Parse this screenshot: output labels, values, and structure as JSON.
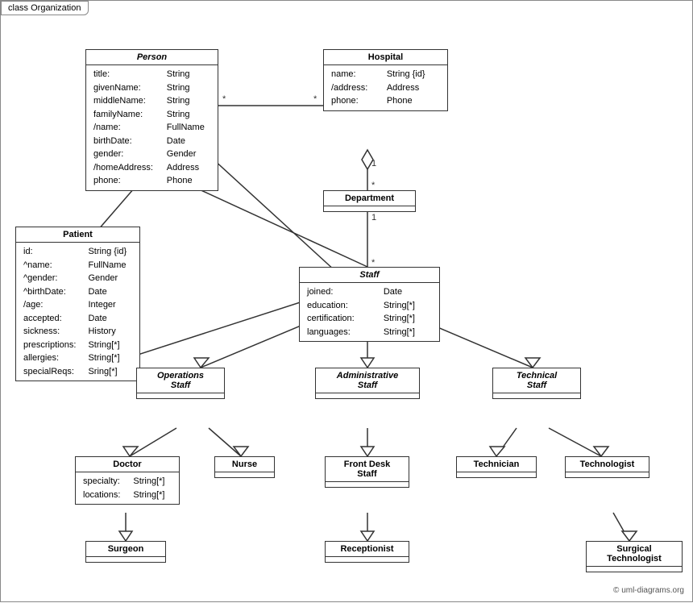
{
  "diagram": {
    "title": "class Organization",
    "copyright": "© uml-diagrams.org",
    "classes": {
      "person": {
        "name": "Person",
        "italic": true,
        "attributes": [
          [
            "title:",
            "String"
          ],
          [
            "givenName:",
            "String"
          ],
          [
            "middleName:",
            "String"
          ],
          [
            "familyName:",
            "String"
          ],
          [
            "/name:",
            "FullName"
          ],
          [
            "birthDate:",
            "Date"
          ],
          [
            "gender:",
            "Gender"
          ],
          [
            "/homeAddress:",
            "Address"
          ],
          [
            "phone:",
            "Phone"
          ]
        ]
      },
      "hospital": {
        "name": "Hospital",
        "italic": false,
        "attributes": [
          [
            "name:",
            "String {id}"
          ],
          [
            "/address:",
            "Address"
          ],
          [
            "phone:",
            "Phone"
          ]
        ]
      },
      "department": {
        "name": "Department",
        "italic": false,
        "attributes": []
      },
      "staff": {
        "name": "Staff",
        "italic": true,
        "attributes": [
          [
            "joined:",
            "Date"
          ],
          [
            "education:",
            "String[*]"
          ],
          [
            "certification:",
            "String[*]"
          ],
          [
            "languages:",
            "String[*]"
          ]
        ]
      },
      "patient": {
        "name": "Patient",
        "italic": false,
        "attributes": [
          [
            "id:",
            "String {id}"
          ],
          [
            "^name:",
            "FullName"
          ],
          [
            "^gender:",
            "Gender"
          ],
          [
            "^birthDate:",
            "Date"
          ],
          [
            "/age:",
            "Integer"
          ],
          [
            "accepted:",
            "Date"
          ],
          [
            "sickness:",
            "History"
          ],
          [
            "prescriptions:",
            "String[*]"
          ],
          [
            "allergies:",
            "String[*]"
          ],
          [
            "specialReqs:",
            "Sring[*]"
          ]
        ]
      },
      "operations_staff": {
        "name": "Operations Staff",
        "italic": true
      },
      "administrative_staff": {
        "name": "Administrative Staff",
        "italic": true
      },
      "technical_staff": {
        "name": "Technical Staff",
        "italic": true
      },
      "doctor": {
        "name": "Doctor",
        "italic": false,
        "attributes": [
          [
            "specialty:",
            "String[*]"
          ],
          [
            "locations:",
            "String[*]"
          ]
        ]
      },
      "nurse": {
        "name": "Nurse",
        "italic": false,
        "attributes": []
      },
      "front_desk_staff": {
        "name": "Front Desk Staff",
        "italic": false,
        "attributes": []
      },
      "technician": {
        "name": "Technician",
        "italic": false,
        "attributes": []
      },
      "technologist": {
        "name": "Technologist",
        "italic": false,
        "attributes": []
      },
      "surgeon": {
        "name": "Surgeon",
        "italic": false,
        "attributes": []
      },
      "receptionist": {
        "name": "Receptionist",
        "italic": false,
        "attributes": []
      },
      "surgical_technologist": {
        "name": "Surgical Technologist",
        "italic": false,
        "attributes": []
      }
    },
    "multiplicity": {
      "star": "*",
      "one": "1"
    }
  }
}
